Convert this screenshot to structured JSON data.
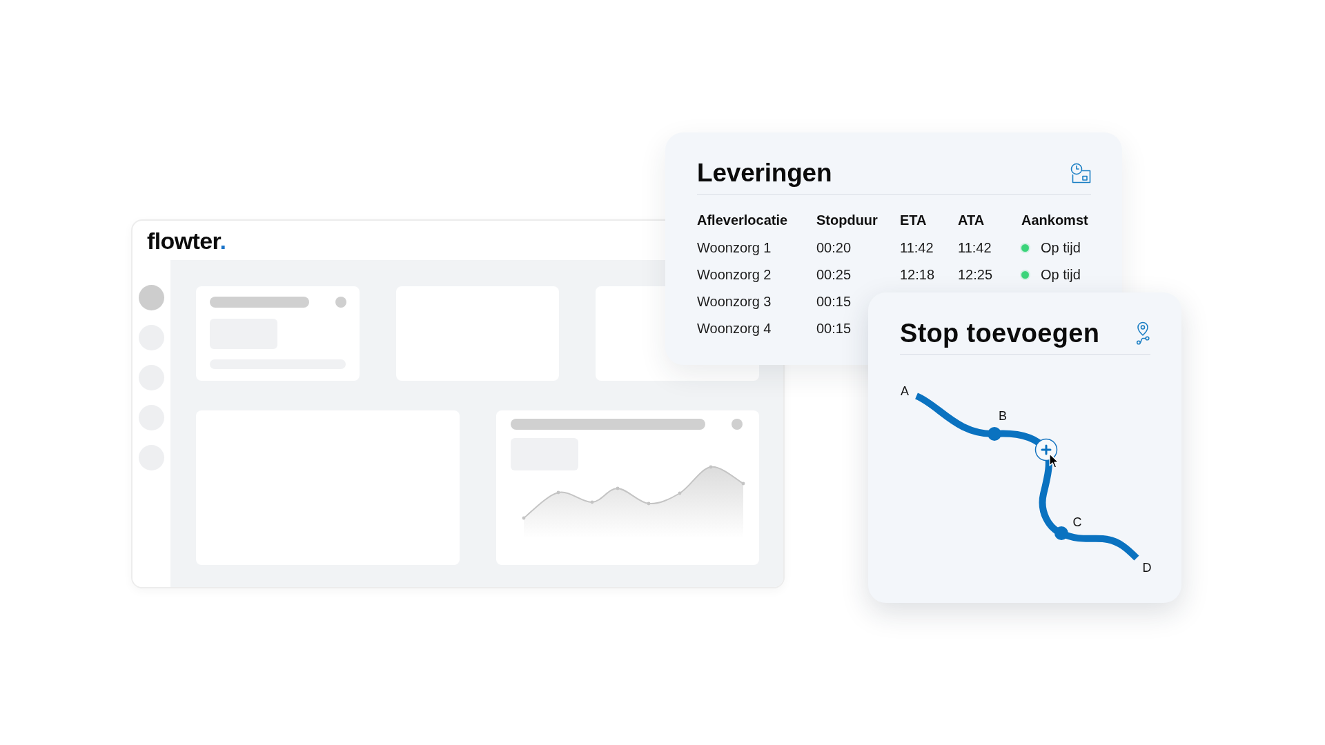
{
  "dashboard": {
    "logo": {
      "text": "flowter",
      "dot": "."
    },
    "sidebar": {
      "items": [
        {
          "selected": true
        },
        {
          "selected": false
        },
        {
          "selected": false
        },
        {
          "selected": false
        },
        {
          "selected": false
        }
      ]
    },
    "widgets": [
      {
        "kind": "stat"
      },
      {
        "kind": "empty"
      },
      {
        "kind": "empty"
      },
      {
        "kind": "empty"
      },
      {
        "kind": "chart"
      }
    ]
  },
  "deliveries": {
    "title": "Leveringen",
    "columns": [
      "Afleverlocatie",
      "Stopduur",
      "ETA",
      "ATA",
      "Aankomst"
    ],
    "rows": [
      {
        "cells": [
          "Woonzorg 1",
          "00:20",
          "11:42",
          "11:42"
        ],
        "status": {
          "label": "Op tijd",
          "color": "#3ad47a"
        }
      },
      {
        "cells": [
          "Woonzorg 2",
          "00:25",
          "12:18",
          "12:25"
        ],
        "status": {
          "label": "Op tijd",
          "color": "#3ad47a"
        }
      },
      {
        "cells": [
          "Woonzorg 3",
          "00:15"
        ]
      },
      {
        "cells": [
          "Woonzorg 4",
          "00:15"
        ]
      }
    ]
  },
  "add_stop": {
    "title": "Stop toevoegen",
    "route": {
      "stops": [
        {
          "label": "A",
          "kind": "endpoint"
        },
        {
          "label": "B",
          "kind": "waypoint"
        },
        {
          "label": "C",
          "kind": "waypoint"
        },
        {
          "label": "D",
          "kind": "endpoint"
        }
      ]
    }
  }
}
